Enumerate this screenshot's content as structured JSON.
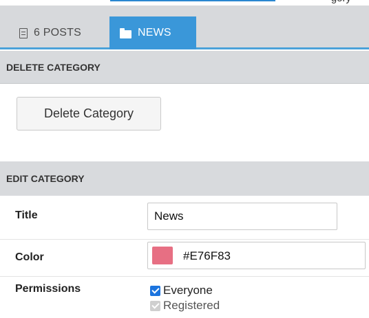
{
  "header": {
    "clipped_text": "gory"
  },
  "tabs": [
    {
      "label": "6 POSTS",
      "icon": "document-icon",
      "active": false
    },
    {
      "label": "NEWS",
      "icon": "folder-icon",
      "active": true
    }
  ],
  "delete_section": {
    "header": "DELETE CATEGORY",
    "button_label": "Delete Category"
  },
  "edit_section": {
    "header": "EDIT CATEGORY",
    "title_label": "Title",
    "title_value": "News",
    "color_label": "Color",
    "color_value": "#E76F83",
    "permissions_label": "Permissions",
    "permissions": [
      {
        "label": "Everyone",
        "checked": true,
        "disabled": false
      },
      {
        "label": "Registered",
        "checked": true,
        "disabled": true
      }
    ]
  },
  "colors": {
    "accent": "#3a97d9",
    "swatch": "#E76F83",
    "checkbox": "#1c74de"
  }
}
